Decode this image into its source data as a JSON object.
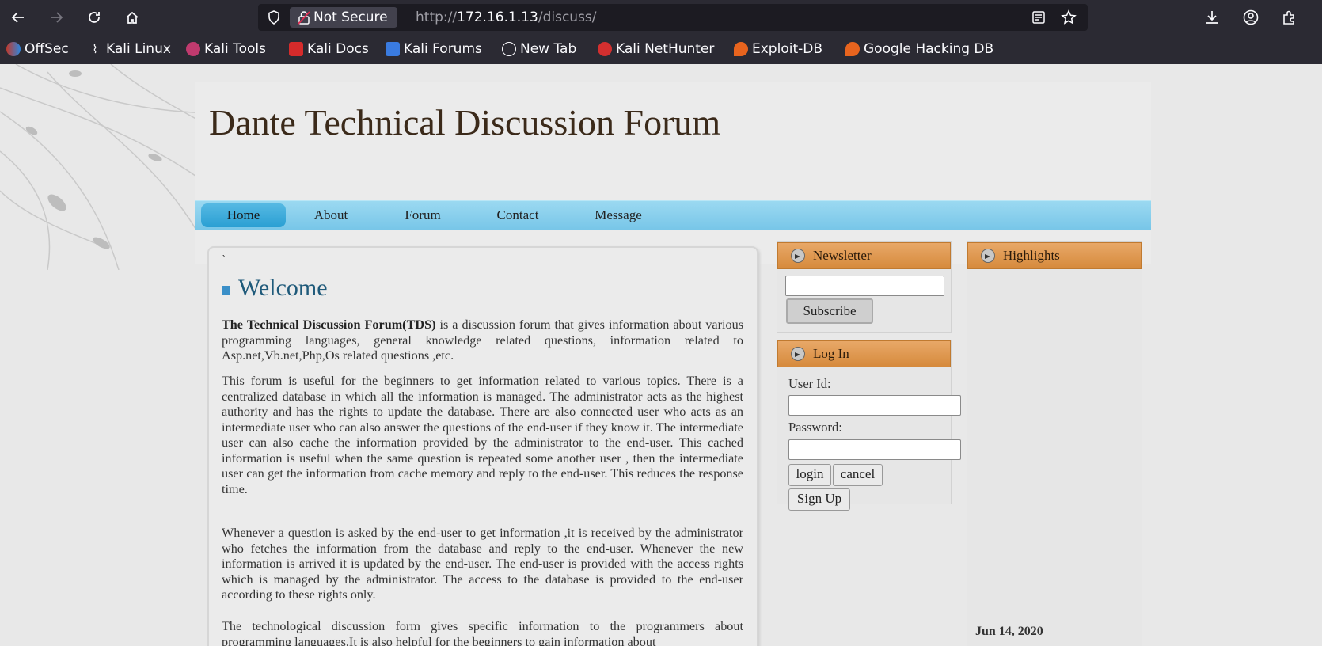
{
  "browser": {
    "security_label": "Not Secure",
    "url_prefix": "http://",
    "url_host": "172.16.1.13",
    "url_path": "/discuss/",
    "bookmarks": [
      "OffSec",
      "Kali Linux",
      "Kali Tools",
      "Kali Docs",
      "Kali Forums",
      "New Tab",
      "Kali NetHunter",
      "Exploit-DB",
      "Google Hacking DB"
    ]
  },
  "site": {
    "title": "Dante Technical Discussion Forum",
    "menu": [
      "Home",
      "About",
      "Forum",
      "Contact",
      "Message"
    ],
    "active_menu": "Home"
  },
  "main": {
    "tick": "`",
    "heading": "Welcome",
    "p1_bold": "The Technical Discussion Forum(TDS)",
    "p1_rest": " is a discussion forum that gives information about various programming languages, general knowledge related questions, information related to Asp.net,Vb.net,Php,Os related questions ,etc.",
    "p2": "This forum is useful for the beginners to get information related to various topics. There is a centralized database in which all the information is managed. The administrator acts as the highest authority and has the rights to update the database. There are also connected user who acts as an intermediate user who can also answer the questions of the end-user if they know it. The intermediate user can also cache the information provided by the administrator to the end-user. This cached information is useful when the same question is repeated some another user , then the intermediate user can get the information from cache memory and reply to the end-user. This reduces the response time.",
    "p3": "Whenever a question is asked by the end-user to get information ,it is received by the administrator who fetches the information from the database and reply to the end-user. Whenever the new information is arrived it is updated by the end-user. The end-user is provided with the access rights which is managed by the administrator. The access to the database is provided to the end-user according to these rights only.",
    "p4": "The technological discussion form gives specific information to the programmers about programming languages.It is also helpful for the beginners to gain information about"
  },
  "newsletter": {
    "title": "Newsletter",
    "email_value": "",
    "subscribe_label": "Subscribe"
  },
  "login": {
    "title": "Log In",
    "user_label": "User Id:",
    "password_label": "Password:",
    "login_label": "login",
    "cancel_label": "cancel",
    "signup_label": "Sign Up"
  },
  "highlights": {
    "title": "Highlights",
    "date": "Jun 14, 2020"
  }
}
